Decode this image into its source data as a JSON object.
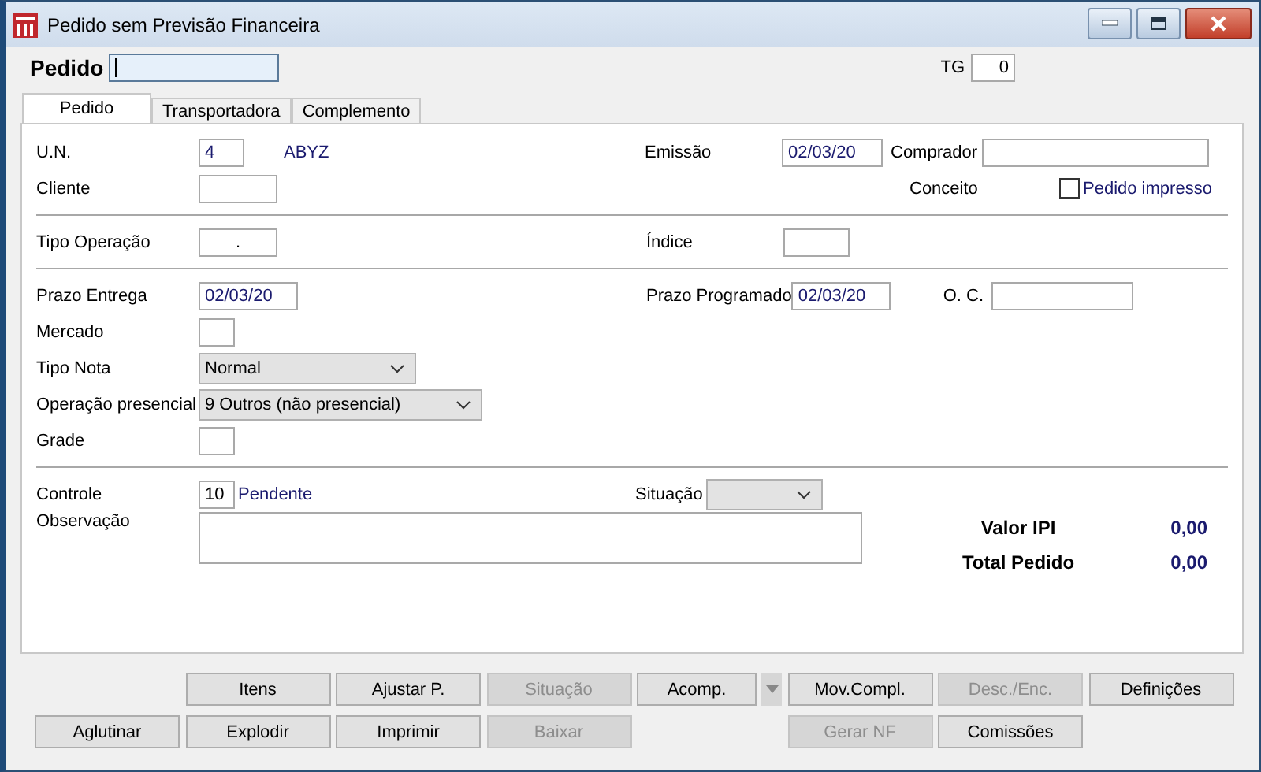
{
  "window": {
    "title": "Pedido sem Previsão Financeira"
  },
  "header": {
    "pedido_label": "Pedido",
    "tg_label": "TG",
    "tg_value": "0"
  },
  "tabs": [
    {
      "label": "Pedido",
      "selected": true
    },
    {
      "label": "Transportadora",
      "selected": false
    },
    {
      "label": "Complemento",
      "selected": false
    }
  ],
  "general": {
    "un": {
      "label": "U.N.",
      "value": "4",
      "description": "ABYZ"
    },
    "emissao": {
      "label": "Emissão",
      "value": "02/03/20"
    },
    "comprador": {
      "label": "Comprador"
    },
    "cliente": {
      "label": "Cliente"
    },
    "conceito": {
      "label": "Conceito"
    },
    "pedido_impresso": {
      "label": "Pedido impresso",
      "checked": false
    }
  },
  "operacao": {
    "tipo_operacao": {
      "label": "Tipo Operação",
      "value": "."
    },
    "indice": {
      "label": "Índice"
    }
  },
  "entrega": {
    "prazo_entrega": {
      "label": "Prazo Entrega",
      "value": "02/03/20"
    },
    "prazo_programado": {
      "label": "Prazo Programado",
      "value": "02/03/20"
    },
    "oc": {
      "label": "O. C."
    },
    "mercado": {
      "label": "Mercado"
    },
    "tipo_nota": {
      "label": "Tipo Nota",
      "value": "Normal"
    },
    "operacao_presencial": {
      "label": "Operação presencial",
      "value": "9 Outros (não presencial)"
    },
    "grade": {
      "label": "Grade"
    }
  },
  "controle": {
    "controle": {
      "label": "Controle",
      "value": "10",
      "status": "Pendente"
    },
    "situacao": {
      "label": "Situação"
    },
    "observacao": {
      "label": "Observação"
    }
  },
  "totals": [
    {
      "label": "Valor IPI",
      "value": "0,00"
    },
    {
      "label": "Total Pedido",
      "value": "0,00"
    }
  ],
  "buttons": [
    [
      {
        "label": "Itens",
        "disabled": false
      },
      {
        "label": "Ajustar P.",
        "disabled": false
      },
      {
        "label": "Situação",
        "disabled": true
      },
      {
        "label": "Acomp.",
        "disabled": false,
        "kind": "split"
      },
      {
        "label": "Mov.Compl.",
        "disabled": false
      },
      {
        "label": "Desc./Enc.",
        "disabled": true
      },
      {
        "label": "Definições",
        "disabled": false
      }
    ],
    [
      {
        "label": "Aglutinar",
        "disabled": false
      },
      {
        "label": "Explodir",
        "disabled": false
      },
      {
        "label": "Imprimir",
        "disabled": false
      },
      {
        "label": "Baixar",
        "disabled": true
      },
      {
        "label": "Gerar NF",
        "disabled": true
      },
      {
        "label": "Comissões",
        "disabled": false
      }
    ]
  ]
}
